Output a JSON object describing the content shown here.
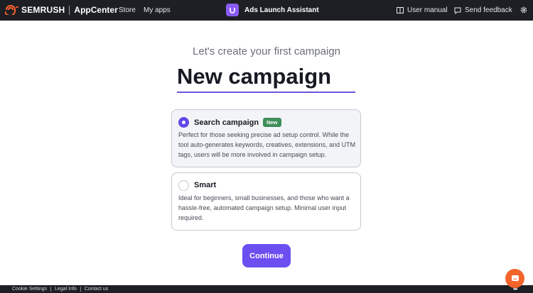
{
  "header": {
    "brand": "SEMRUSH",
    "app_center": "AppCenter",
    "nav": [
      "Store",
      "My apps"
    ],
    "app_name": "Ads Launch Assistant",
    "user_manual": "User manual",
    "send_feedback": "Send feedback",
    "icons": {
      "brand": "semrush-flame-icon",
      "app": "ads-launch-assistant-icon",
      "manual": "book-icon",
      "feedback": "comment-icon",
      "settings": "gear-icon"
    }
  },
  "main": {
    "subtitle": "Let's create your first campaign",
    "campaign_name": "New campaign",
    "options": [
      {
        "title": "Search campaign",
        "badge": "New",
        "description": "Perfect for those seeking precise ad setup control. While the tool auto-generates keywords, creatives, extensions, and UTM tags, users will be more involved in campaign setup.",
        "selected": true
      },
      {
        "title": "Smart",
        "description": "Ideal for beginners, small businesses, and those who want a hassle-free, automated campaign setup. Minimal user input required.",
        "selected": false
      }
    ],
    "continue_label": "Continue"
  },
  "footer": {
    "links": [
      "Cookie Settings",
      "Legal Info",
      "Contact us"
    ],
    "more_icon": "ellipsis-icon"
  },
  "colors": {
    "accent": "#6b4ff0",
    "badge": "#3f8f5a",
    "chat": "#f2642c",
    "topbar": "#1d1f24"
  }
}
